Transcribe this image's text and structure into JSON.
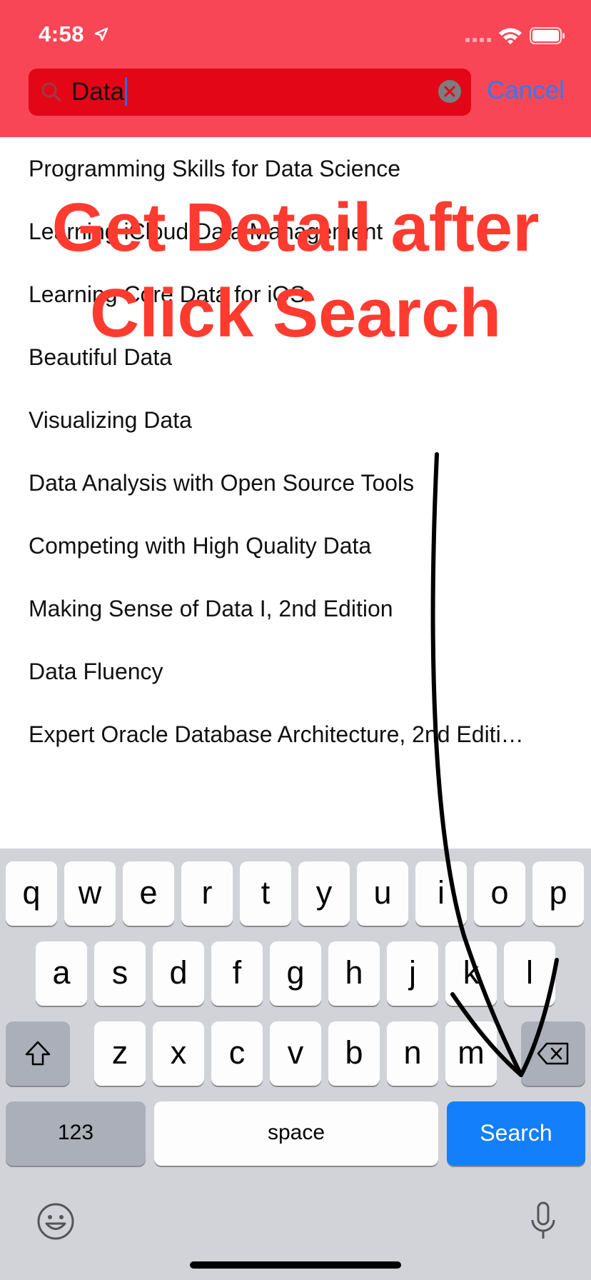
{
  "status_bar": {
    "time": "4:58"
  },
  "search": {
    "query": "Data",
    "cancel_label": "Cancel"
  },
  "results": [
    "Programming Skills for Data Science",
    "Learning iCloud Data Management",
    "Learning Core Data for iOS",
    "Beautiful Data",
    "Visualizing Data",
    "Data Analysis with Open Source Tools",
    "Competing with High Quality Data",
    "Making Sense of Data I, 2nd Edition",
    "Data Fluency",
    "Expert Oracle Database Architecture, 2nd Editi…"
  ],
  "overlay": {
    "line1": "Get Detail after",
    "line2": "Click Search"
  },
  "keyboard": {
    "row1": [
      "q",
      "w",
      "e",
      "r",
      "t",
      "y",
      "u",
      "i",
      "o",
      "p"
    ],
    "row2": [
      "a",
      "s",
      "d",
      "f",
      "g",
      "h",
      "j",
      "k",
      "l"
    ],
    "row3": [
      "z",
      "x",
      "c",
      "v",
      "b",
      "n",
      "m"
    ],
    "numbers_label": "123",
    "space_label": "space",
    "search_label": "Search"
  },
  "colors": {
    "header_bg": "#f94656",
    "search_field_bg": "#e30617",
    "cancel": "#2c7cf6",
    "overlay_text": "#ff3b30",
    "search_key": "#137ffb"
  },
  "icons": [
    "location-arrow-icon",
    "cellular-signal-icon",
    "wifi-icon",
    "battery-icon",
    "search-icon",
    "clear-icon",
    "shift-icon",
    "delete-icon",
    "emoji-icon",
    "microphone-icon"
  ]
}
